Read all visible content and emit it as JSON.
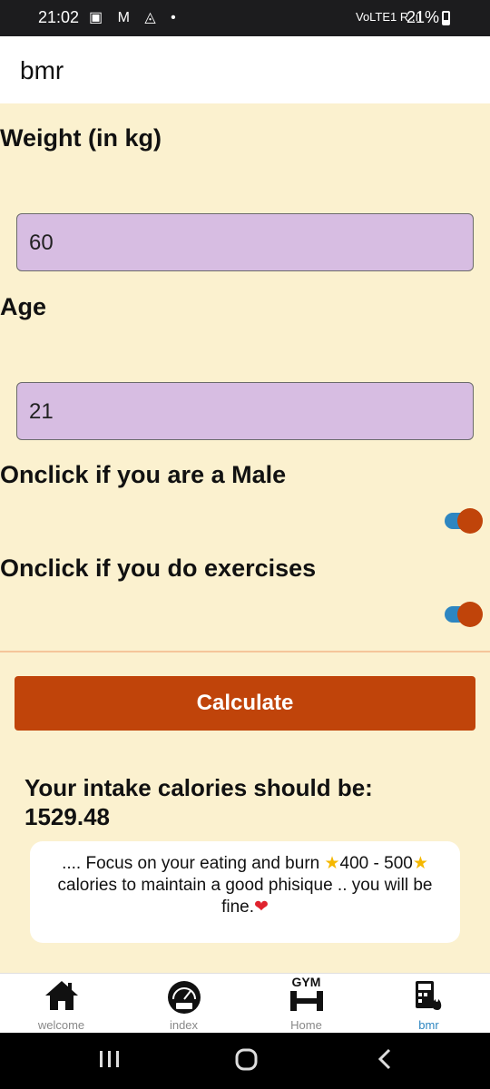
{
  "status_bar": {
    "time": "21:02",
    "left_icons": "▣ M ◬ •",
    "network": "VoLTE1 R .ıl",
    "battery": "21%"
  },
  "app_bar": {
    "title": "bmr"
  },
  "form": {
    "weight_label": "Weight (in kg)",
    "weight_value": "60",
    "age_label": "Age",
    "age_value": "21",
    "male_label": "Onclick if you are a Male",
    "male_on": true,
    "exercise_label": "Onclick if you do exercises",
    "exercise_on": true
  },
  "calculate_label": "Calculate",
  "result": {
    "heading": "Your intake calories should be:",
    "value": "1529.48"
  },
  "tip": {
    "text_1": ".... Focus on your eating and burn ",
    "range": "400 - 500",
    "text_2": " calories to maintain a good phisique .. you will be fine."
  },
  "bottom_nav": {
    "items": [
      {
        "label": "welcome",
        "icon": "home-icon"
      },
      {
        "label": "index",
        "icon": "bmi-gauge-icon"
      },
      {
        "label": "Home",
        "icon": "gym-dumbbell-icon",
        "icon_text": "GYM"
      },
      {
        "label": "bmr",
        "icon": "calculator-fire-icon",
        "active": true
      }
    ]
  },
  "colors": {
    "background": "#fbf1cf",
    "accent": "#c0440a",
    "field": "#d7bde2",
    "toggle_track": "#2e86c1"
  }
}
